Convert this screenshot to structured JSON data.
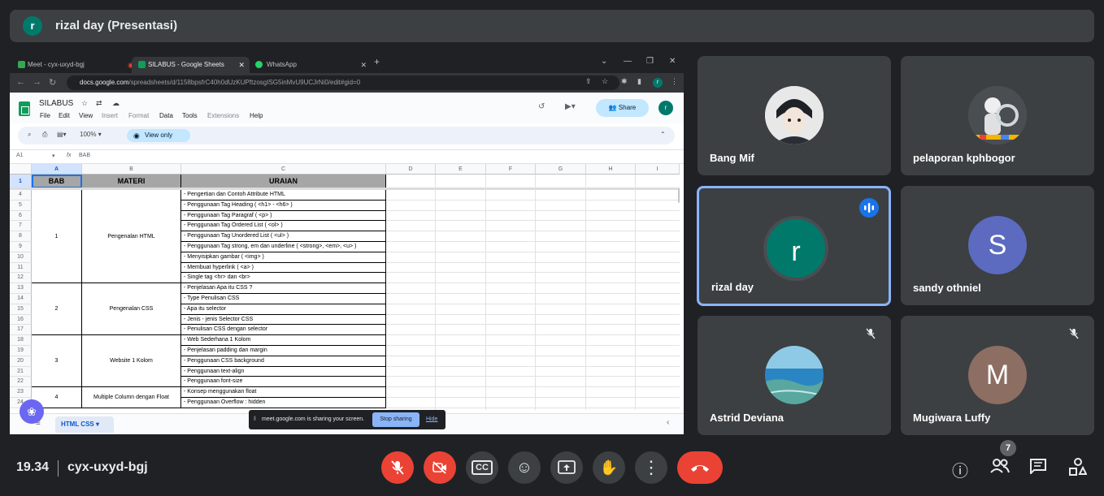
{
  "meeting": {
    "presenter_initial": "r",
    "presenter_title": "rizal day (Presentasi)",
    "time": "19.34",
    "code": "cyx-uxyd-bgj",
    "participant_count": "7"
  },
  "browser": {
    "tabs": [
      {
        "label": "Meet - cyx-uxyd-bgj",
        "icon": "meet-icon",
        "color": "#34a853"
      },
      {
        "label": "SILABUS - Google Sheets",
        "icon": "sheets-icon",
        "color": "#0f9d58"
      },
      {
        "label": "WhatsApp",
        "icon": "whatsapp-icon",
        "color": "#25d366"
      }
    ],
    "url_host": "docs.google.com",
    "url_rest": "/spreadsheets/d/1158bpsfrC40h0dUzKUPftzosgISG5inMvU9UCJrNi0/edit#gid=0",
    "avatar": "r"
  },
  "sheet": {
    "doc_title": "SILABUS",
    "menus": [
      "File",
      "Edit",
      "View",
      "Insert",
      "Format",
      "Data",
      "Tools",
      "Extensions",
      "Help"
    ],
    "share_label": "Share",
    "avatar": "r",
    "zoom": "100%",
    "view_only": "View only",
    "cell_ref": "A1",
    "fx_label": "fx",
    "fx_value": "BAB",
    "columns": [
      "A",
      "B",
      "C",
      "D",
      "E",
      "F",
      "G",
      "H",
      "I"
    ],
    "header_row": [
      "BAB",
      "MATERI",
      "URAIAN"
    ],
    "row_numbers": [
      "1",
      "4",
      "5",
      "6",
      "7",
      "8",
      "9",
      "10",
      "11",
      "12",
      "13",
      "14",
      "15",
      "16",
      "17",
      "18",
      "19",
      "20",
      "21",
      "22",
      "23",
      "24"
    ],
    "chapters": [
      {
        "bab": "1",
        "materi": "Pengenalan HTML"
      },
      {
        "bab": "2",
        "materi": "Pengenalan CSS"
      },
      {
        "bab": "3",
        "materi": "Website 1 Kolom"
      },
      {
        "bab": "4",
        "materi": "Multiple Column dengan Float"
      }
    ],
    "uraian": [
      "- Pengertian dan Contoh Attribute HTML",
      "- Penggunaan Tag Heading ( <h1> - <h6> )",
      "- Penggunaan Tag Paragraf ( <p> )",
      "- Penggunaan Tag Ordered List ( <ol> )",
      "- Penggunaan Tag Unordered List ( <ul> )",
      "- Penggunaan Tag strong, em dan underline ( <strong>, <em>, <u> )",
      "- Menyisipkan gambar ( <img> )",
      "- Membuat hyperlink ( <a> )",
      "- Single tag <hr> dan <br>",
      "- Penjelasan Apa itu CSS ?",
      "- Type Penulisan CSS",
      "- Apa itu selector",
      "- Jenis - jenis Selector CSS",
      "- Penulisan CSS dengan selector",
      "- Web Sederhana 1 Kolom",
      "- Penjelasan padding dan margin",
      "- Penggunaan CSS background",
      "- Penggunaan text-align",
      "- Penggunaan font-size",
      "- Konsep menggunakan float",
      "- Penggunaan Overflow : hidden"
    ],
    "sheet_tab": "HTML CSS"
  },
  "share_banner": {
    "text": "meet.google.com is sharing your screen.",
    "stop": "Stop sharing",
    "hide": "Hide"
  },
  "participants": [
    {
      "name": "Bang Mif",
      "initial": "",
      "muted": false,
      "speaking": false,
      "color": "#cfd8dc"
    },
    {
      "name": "pelaporan kphbogor",
      "initial": "",
      "muted": false,
      "speaking": false,
      "color": "#5f6368"
    },
    {
      "name": "rizal day",
      "initial": "r",
      "muted": false,
      "speaking": true,
      "color": "#00796b"
    },
    {
      "name": "sandy othniel",
      "initial": "S",
      "muted": false,
      "speaking": false,
      "color": "#5c6bc0"
    },
    {
      "name": "Astrid Deviana",
      "initial": "",
      "muted": true,
      "speaking": false,
      "color": "#4fa3d6"
    },
    {
      "name": "Mugiwara Luffy",
      "initial": "M",
      "muted": true,
      "speaking": false,
      "color": "#8d6e63"
    }
  ]
}
